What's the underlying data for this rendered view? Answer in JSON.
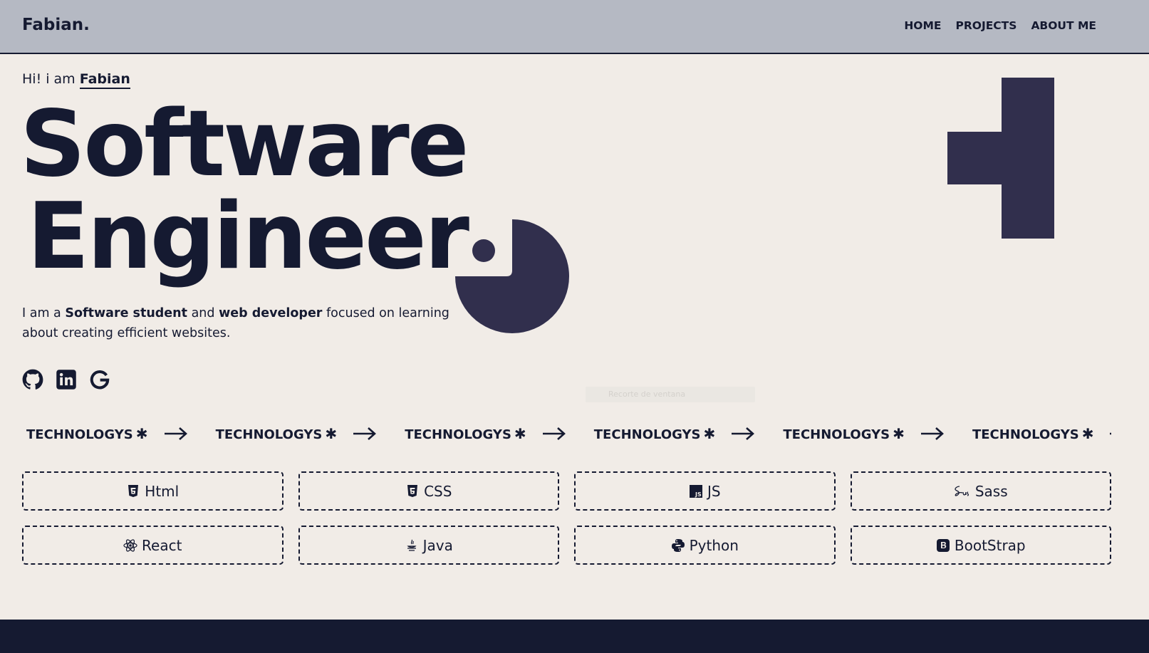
{
  "header": {
    "logo": "Fabian.",
    "nav": [
      {
        "label": "HOME"
      },
      {
        "label": "PROJECTS"
      },
      {
        "label": "ABOUT ME"
      }
    ]
  },
  "hero": {
    "greeting_prefix": "Hi! i am ",
    "greeting_name": "Fabian",
    "title_line1": "Software",
    "title_line2": "Engineer",
    "desc_1": "I am a ",
    "desc_b1": "Software student",
    "desc_2": " and ",
    "desc_b2": "web developer",
    "desc_3": " focused on learning about creating efficient websites."
  },
  "socials": [
    {
      "icon": "github-icon"
    },
    {
      "icon": "linkedin-icon"
    },
    {
      "icon": "google-icon"
    }
  ],
  "overlay_faint_text": "Recorte de ventana",
  "marquee": {
    "label": "TECHNOLOGYS",
    "star": "✱",
    "truncated": "T"
  },
  "technologies": [
    {
      "label": "Html",
      "icon": "html5-icon"
    },
    {
      "label": "CSS",
      "icon": "css3-icon"
    },
    {
      "label": "JS",
      "icon": "js-icon"
    },
    {
      "label": "Sass",
      "icon": "sass-icon"
    },
    {
      "label": "React",
      "icon": "react-icon"
    },
    {
      "label": "Java",
      "icon": "java-icon"
    },
    {
      "label": "Python",
      "icon": "python-icon"
    },
    {
      "label": "BootStrap",
      "icon": "bootstrap-icon"
    }
  ],
  "colors": {
    "background": "#f1ece7",
    "header": "#b5b9c3",
    "ink": "#151a31",
    "shape": "#312f4d"
  }
}
